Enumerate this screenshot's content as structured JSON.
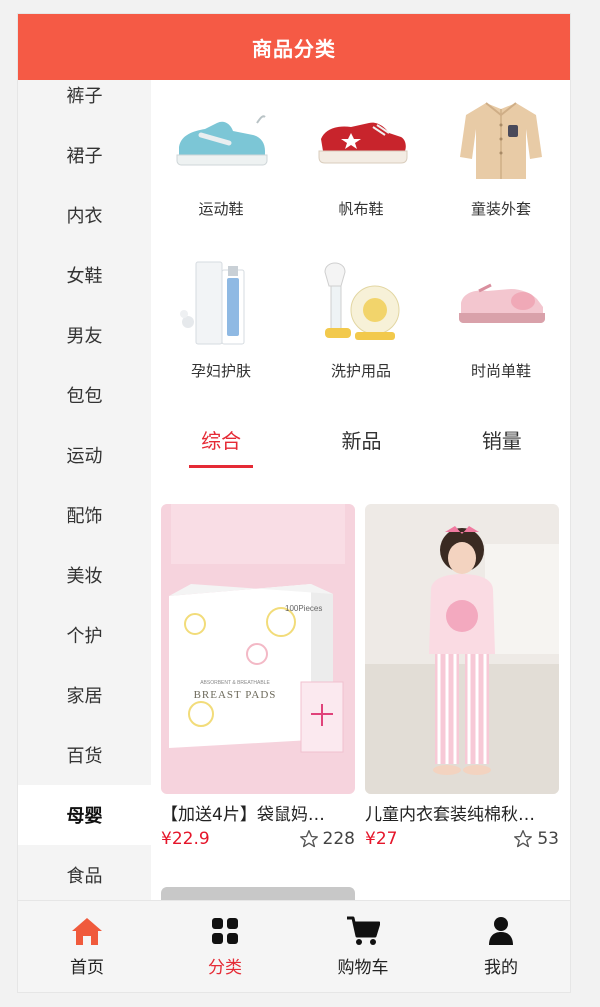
{
  "header": {
    "title": "商品分类"
  },
  "sidebar": {
    "items": [
      {
        "label": "裤子"
      },
      {
        "label": "裙子"
      },
      {
        "label": "内衣"
      },
      {
        "label": "女鞋"
      },
      {
        "label": "男友"
      },
      {
        "label": "包包"
      },
      {
        "label": "运动"
      },
      {
        "label": "配饰"
      },
      {
        "label": "美妆"
      },
      {
        "label": "个护"
      },
      {
        "label": "家居"
      },
      {
        "label": "百货"
      },
      {
        "label": "母婴",
        "active": true
      },
      {
        "label": "食品"
      }
    ]
  },
  "subcategories": [
    {
      "label": "运动鞋",
      "icon": "sneaker-image"
    },
    {
      "label": "帆布鞋",
      "icon": "canvas-shoe-image"
    },
    {
      "label": "童装外套",
      "icon": "kids-sweater-image"
    },
    {
      "label": "孕妇护肤",
      "icon": "skincare-bottle-image"
    },
    {
      "label": "洗护用品",
      "icon": "breast-pump-image"
    },
    {
      "label": "时尚单鞋",
      "icon": "pink-shoe-image"
    }
  ],
  "sort_tabs": [
    {
      "label": "综合",
      "active": true
    },
    {
      "label": "新品"
    },
    {
      "label": "销量"
    }
  ],
  "products": [
    {
      "title": "【加送4片】袋鼠妈…",
      "price": "¥22.9",
      "favorites": "228",
      "box_brand": "100Pieces",
      "box_subtitle": "ABSORBENT & BREATHABLE",
      "box_title": "BREAST PADS"
    },
    {
      "title": "儿童内衣套装纯棉秋…",
      "price": "¥27",
      "favorites": "53"
    }
  ],
  "tabbar": {
    "items": [
      {
        "label": "首页",
        "icon": "home-icon",
        "active": false
      },
      {
        "label": "分类",
        "icon": "grid-icon",
        "active": true
      },
      {
        "label": "购物车",
        "icon": "cart-icon",
        "active": false
      },
      {
        "label": "我的",
        "icon": "user-icon",
        "active": false
      }
    ]
  },
  "colors": {
    "brand": "#f55a45",
    "accent_red": "#e52a35",
    "price_red": "#e5152a"
  }
}
